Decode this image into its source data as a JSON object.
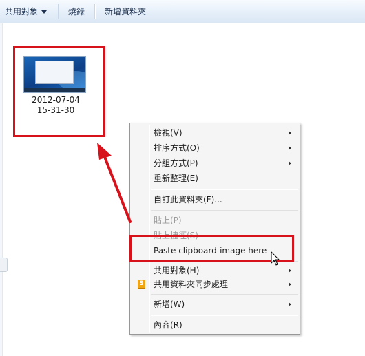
{
  "toolbar": {
    "share_label": "共用對象",
    "burn_label": "燒錄",
    "new_folder_label": "新增資料夾"
  },
  "file": {
    "name_line1": "2012-07-04",
    "name_line2": "15-31-30"
  },
  "context_menu": {
    "items": [
      {
        "label": "檢視(V)",
        "submenu": true,
        "enabled": true
      },
      {
        "label": "排序方式(O)",
        "submenu": true,
        "enabled": true
      },
      {
        "label": "分組方式(P)",
        "submenu": true,
        "enabled": true
      },
      {
        "label": "重新整理(E)",
        "submenu": false,
        "enabled": true
      },
      {
        "label": "自訂此資料夾(F)...",
        "submenu": false,
        "enabled": true
      },
      {
        "label": "貼上(P)",
        "submenu": false,
        "enabled": false
      },
      {
        "label": "貼上捷徑(S)",
        "submenu": false,
        "enabled": false
      },
      {
        "label": "Paste clipboard-image here",
        "submenu": false,
        "enabled": true
      },
      {
        "label": "共用對象(H)",
        "submenu": true,
        "enabled": true
      },
      {
        "label": "共用資料夾同步處理",
        "submenu": true,
        "enabled": true
      },
      {
        "label": "新增(W)",
        "submenu": true,
        "enabled": true
      },
      {
        "label": "內容(R)",
        "submenu": false,
        "enabled": true
      }
    ],
    "sync_icon_glyph": "S"
  },
  "icons": {
    "sync": "sync-folder-icon",
    "cursor": "mouse-pointer-icon",
    "arrow": "annotation-arrow"
  },
  "colors": {
    "annotation": "#d8121b",
    "toolbar_text": "#1e3250",
    "disabled_text": "#9a9a9a"
  }
}
